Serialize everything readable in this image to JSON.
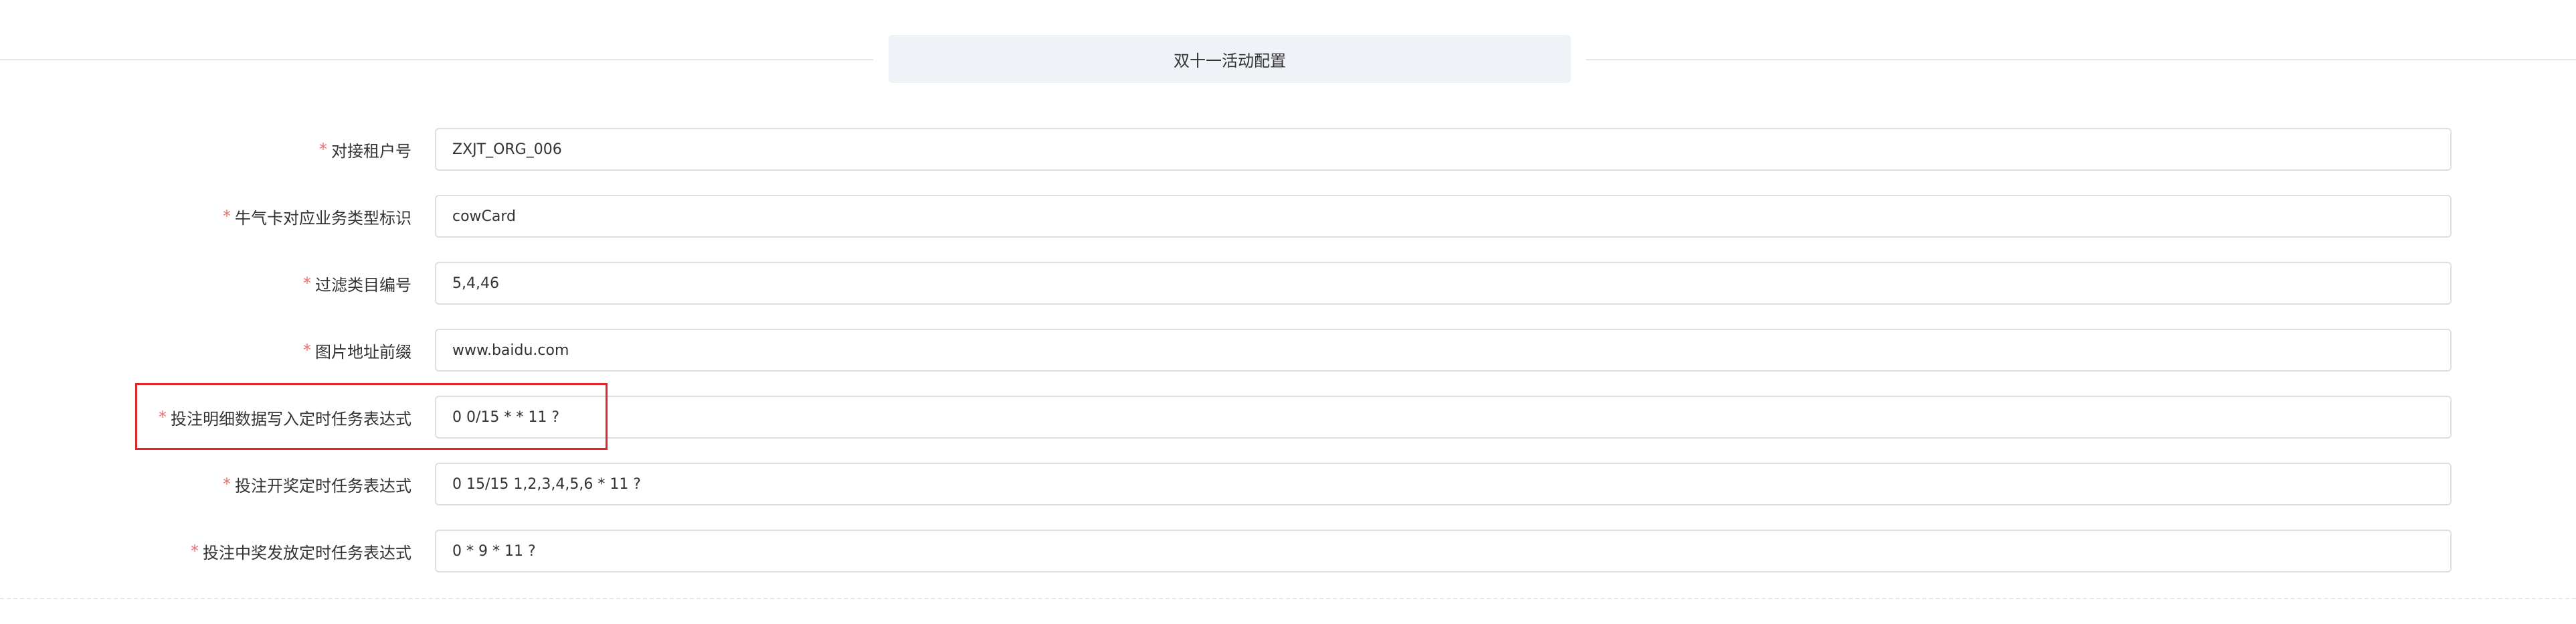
{
  "section": {
    "title": "双十一活动配置"
  },
  "form": {
    "fields": [
      {
        "label": "对接租户号",
        "value": "ZXJT_ORG_006",
        "required": "*"
      },
      {
        "label": "牛气卡对应业务类型标识",
        "value": "cowCard",
        "required": "*"
      },
      {
        "label": "过滤类目编号",
        "value": "5,4,46",
        "required": "*"
      },
      {
        "label": "图片地址前缀",
        "value": "www.baidu.com",
        "required": "*"
      },
      {
        "label": "投注明细数据写入定时任务表达式",
        "value": "0 0/15 * * 11 ?",
        "required": "*"
      },
      {
        "label": "投注开奖定时任务表达式",
        "value": "0 15/15 1,2,3,4,5,6 * 11 ?",
        "required": "*"
      },
      {
        "label": "投注中奖发放定时任务表达式",
        "value": "0 * 9 * 11 ?",
        "required": "*"
      }
    ]
  },
  "colors": {
    "required_star": "#f56c6c",
    "highlight_border": "#e0262b",
    "section_title_bg": "#eff2f7",
    "input_border": "#dcdfe6"
  }
}
